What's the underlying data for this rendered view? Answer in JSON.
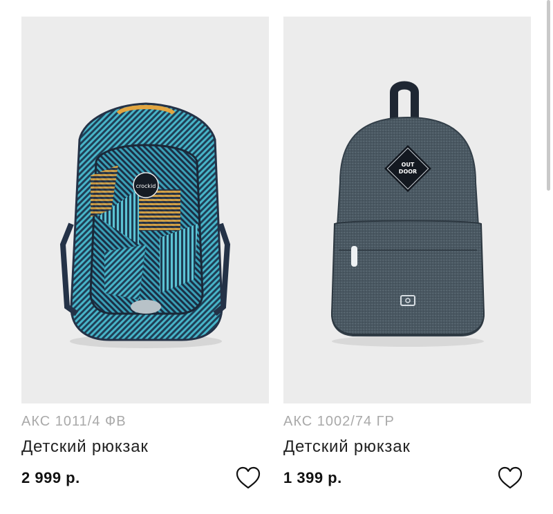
{
  "products": [
    {
      "sku": "АКС 1011/4 ФВ",
      "title": "Детский рюкзак",
      "price": "2 999 р.",
      "image_alt": "backpack-crockid-geometric",
      "brand_patch": "crockid",
      "colors": {
        "bg": "#ececec",
        "main": "#3fa6b8",
        "accent": "#e0a43a",
        "dark": "#1c2a36"
      }
    },
    {
      "sku": "АКС 1002/74 ГР",
      "title": "Детский рюкзак",
      "price": "1 399 р.",
      "image_alt": "backpack-outdoor-grey",
      "brand_patch": [
        "OUT",
        "DOOR"
      ],
      "colors": {
        "bg": "#ececec",
        "main": "#4b5963",
        "dark": "#1c2430"
      }
    }
  ],
  "favorite_icon": "heart-outline-icon"
}
